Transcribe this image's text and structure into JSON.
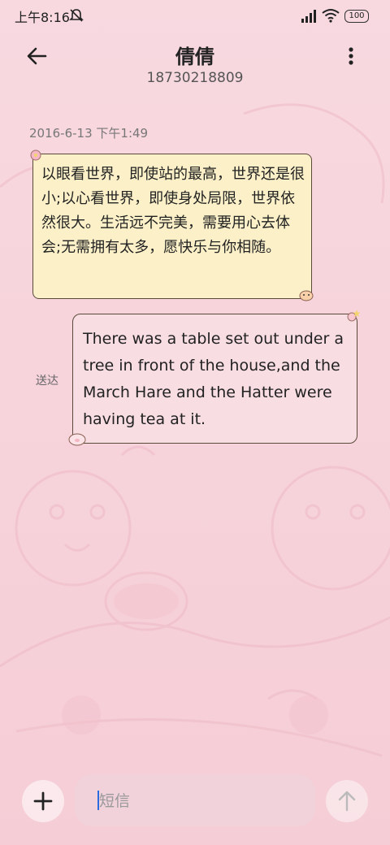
{
  "statusbar": {
    "time": "上午8:16",
    "battery": "100"
  },
  "header": {
    "contact_name": "倩倩",
    "contact_number": "18730218809"
  },
  "thread": {
    "timestamp": "2016-6-13 下午1:49",
    "messages": [
      {
        "direction": "incoming",
        "text": "以眼看世界，即使站的最高，世界还是很小;以心看世界，即使身处局限，世界依然很大。生活远不完美，需要用心去体会;无需拥有太多，愿快乐与你相随。"
      },
      {
        "direction": "outgoing",
        "text": "There was a table set out under a tree in front of the house,and the March Hare and the Hatter were having tea at it.",
        "status": "送达"
      }
    ]
  },
  "composer": {
    "placeholder": "短信"
  },
  "colors": {
    "background": "#f7d4dc",
    "incoming_bubble": "#fbf0c8",
    "outgoing_bubble": "#f8dde3",
    "cursor": "#2a6be0"
  }
}
